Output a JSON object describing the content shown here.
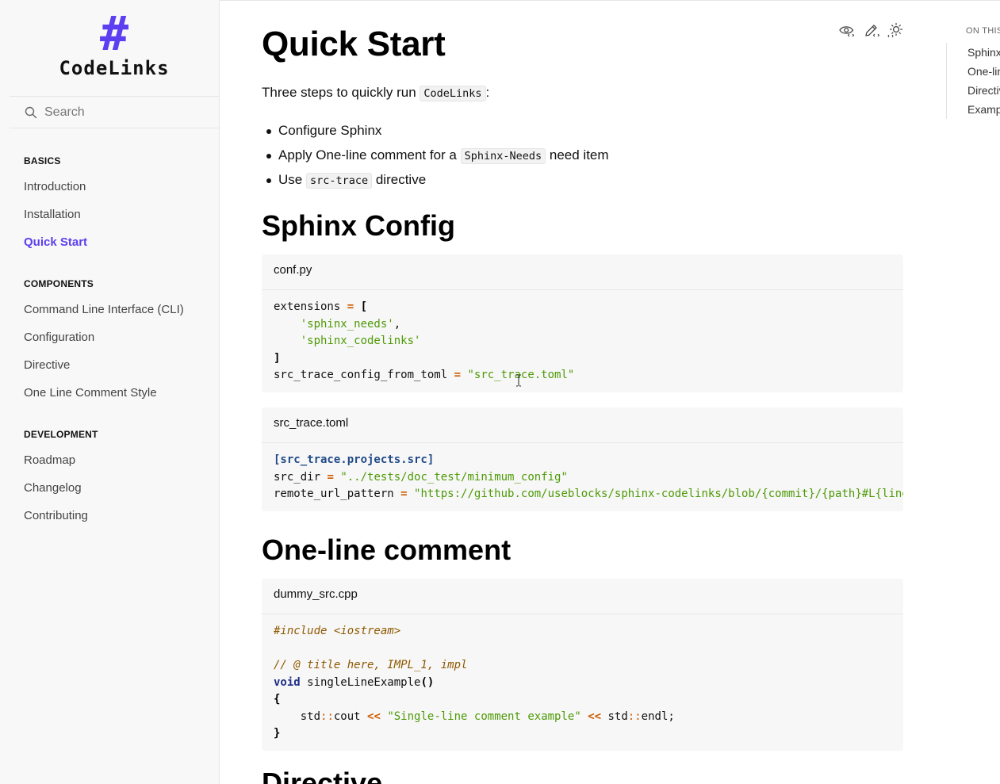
{
  "sidebar": {
    "logo_mark": "#",
    "logo_text": "CodeLinks",
    "search_placeholder": "Search",
    "sections": [
      {
        "heading": "BASICS",
        "items": [
          {
            "label": "Introduction",
            "active": false
          },
          {
            "label": "Installation",
            "active": false
          },
          {
            "label": "Quick Start",
            "active": true
          }
        ]
      },
      {
        "heading": "COMPONENTS",
        "items": [
          {
            "label": "Command Line Interface (CLI)",
            "active": false
          },
          {
            "label": "Configuration",
            "active": false
          },
          {
            "label": "Directive",
            "active": false
          },
          {
            "label": "One Line Comment Style",
            "active": false
          }
        ]
      },
      {
        "heading": "DEVELOPMENT",
        "items": [
          {
            "label": "Roadmap",
            "active": false
          },
          {
            "label": "Changelog",
            "active": false
          },
          {
            "label": "Contributing",
            "active": false
          }
        ]
      }
    ]
  },
  "page": {
    "title": "Quick Start",
    "intro_text": "Three steps to quickly run ",
    "intro_code": "CodeLinks",
    "intro_suffix": ":",
    "steps": {
      "step1": "Configure Sphinx",
      "step2_prefix": "Apply One-line comment for a ",
      "step2_code": "Sphinx-Needs",
      "step2_suffix": " need item",
      "step3_prefix": "Use ",
      "step3_code": "src-trace",
      "step3_suffix": " directive"
    },
    "section_sphinx_config": "Sphinx Config",
    "section_one_line_comment": "One-line comment",
    "section_next_partial": "Directive"
  },
  "code_blocks": {
    "conf": {
      "caption": "conf.py",
      "lines": {
        "l1_name": "extensions",
        "l1_op": "=",
        "l1_bracket": "[",
        "l2_str": "'sphinx_needs'",
        "l2_comma": ",",
        "l3_str": "'sphinx_codelinks'",
        "l4_bracket": "]",
        "l5_name": "src_trace_config_from_toml",
        "l5_op": "=",
        "l5_str": "\"src_trace.toml\""
      }
    },
    "toml": {
      "caption": "src_trace.toml",
      "lines": {
        "l1_table": "[src_trace.projects.src]",
        "l2_name": "src_dir",
        "l2_op": "=",
        "l2_str": "\"../tests/doc_test/minimum_config\"",
        "l3_name": "remote_url_pattern",
        "l3_op": "=",
        "l3_str": "\"https://github.com/useblocks/sphinx-codelinks/blob/{commit}/{path}#L{lineno}\""
      }
    },
    "cpp": {
      "caption": "dummy_src.cpp",
      "lines": {
        "l1_preproc": "#include <iostream>",
        "l3_comment": "// @ title here, IMPL_1, impl",
        "l4_type": "void",
        "l4_name": " singleLineExample",
        "l4_parens": "()",
        "l5_brace": "{",
        "l6_ns1": "std",
        "l6_scope1": "::",
        "l6_cout": "cout ",
        "l6_op1": "<<",
        "l6_str": "\"Single-line comment example\"",
        "l6_op2": "<<",
        "l6_ns2": "std",
        "l6_scope2": "::",
        "l6_endl": "endl;",
        "l7_brace": "}"
      }
    }
  },
  "toolbar": {
    "view_source_icon": "eye-code-icon",
    "edit_icon": "pencil-icon",
    "theme_icon": "sun-moon-icon"
  },
  "toc": {
    "title": "ON THIS PAGE",
    "items": [
      "Sphinx Config",
      "One-line comment",
      "Directive",
      "Example"
    ]
  },
  "colors": {
    "accent": "#5b3ff0",
    "sidebar_bg": "#f8f8f8",
    "code_bg": "#f7f7f7",
    "string": "#4e9a06",
    "operator": "#ce5c00",
    "comment": "#8f5902",
    "keyword": "#204a87"
  }
}
